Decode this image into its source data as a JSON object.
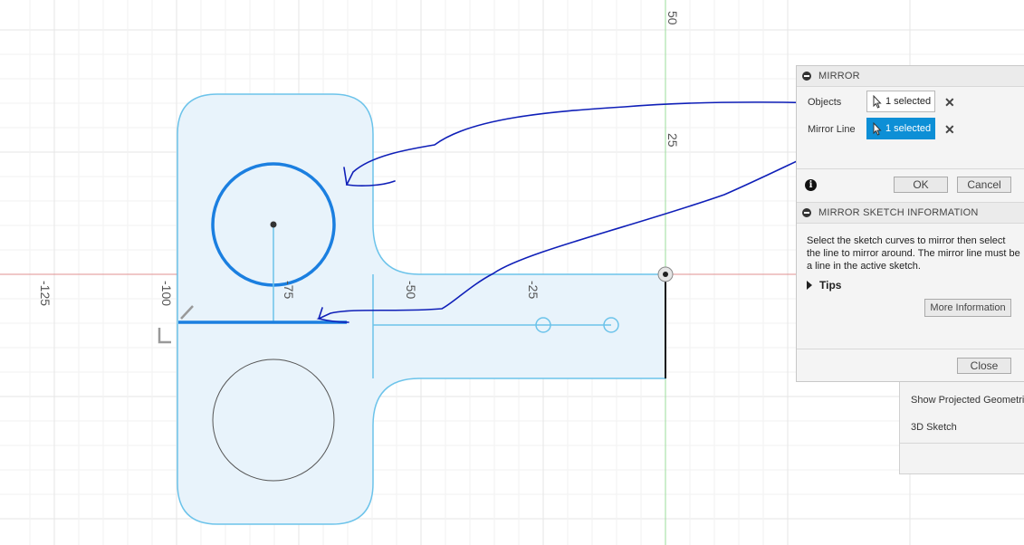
{
  "viewport": {
    "axis_labels": {
      "x_neg125": "-125",
      "x_neg100": "-100",
      "x_neg75": "-75",
      "x_neg50": "-50",
      "x_neg25": "-25",
      "y_50": "50",
      "y_25": "25"
    }
  },
  "colors": {
    "sketch_fill": "#e8f3fb",
    "sketch_line": "#6cc3ea",
    "selected_line": "#1b7fe0",
    "annotation_ink": "#0f1fb8",
    "x_axis": "#e09090",
    "y_axis": "#9bdc9b",
    "accent": "#0d8fd6"
  },
  "palette": {
    "show_projected": "Show Projected Geometries",
    "sketch_3d": "3D Sketch"
  },
  "mirror_dialog": {
    "title": "MIRROR",
    "objects_label": "Objects",
    "objects_value": "1 selected",
    "mirror_line_label": "Mirror Line",
    "mirror_line_value": "1 selected",
    "ok": "OK",
    "cancel": "Cancel",
    "info_title": "MIRROR SKETCH INFORMATION",
    "info_text": "Select the sketch curves to mirror then select the line to mirror around. The mirror line must be a line in the active sketch.",
    "tips": "Tips",
    "more_info": "More Information",
    "close": "Close"
  }
}
